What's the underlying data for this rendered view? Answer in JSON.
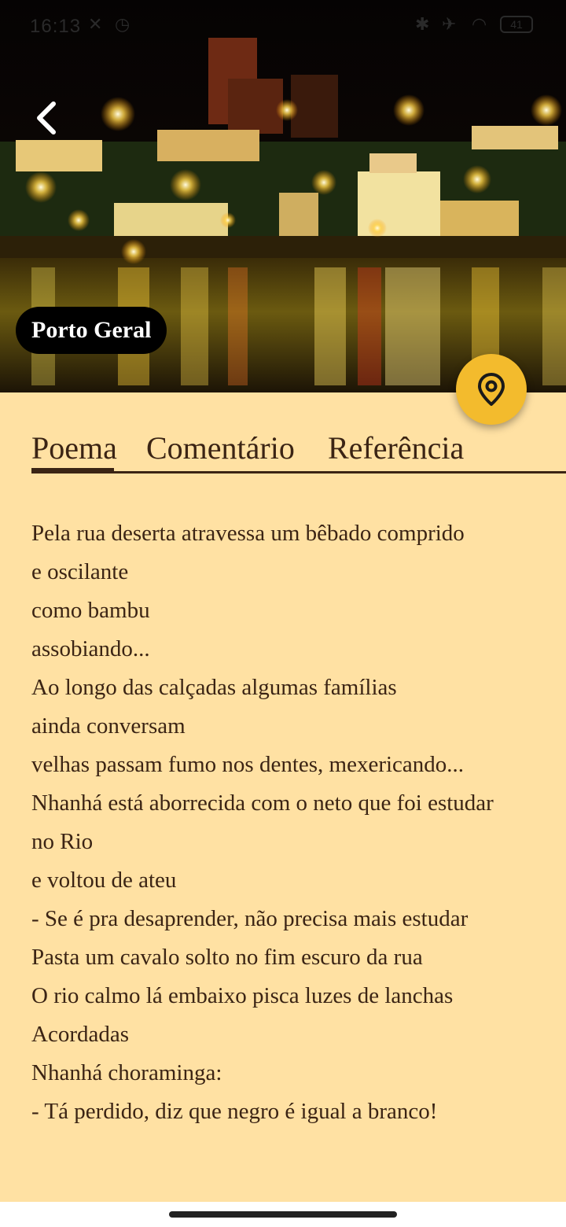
{
  "status_bar": {
    "time": "16:13",
    "icons": [
      "bluetooth-icon",
      "airplane-mode-icon",
      "wifi-icon",
      "battery-icon"
    ],
    "battery_text": "41"
  },
  "header": {
    "place_name": "Porto Geral",
    "back_icon": "chevron-left-icon",
    "map_icon": "location-pin-icon"
  },
  "tabs": [
    {
      "label": "Poema",
      "selected": true
    },
    {
      "label": "Comentário",
      "selected": false
    },
    {
      "label": "Referência",
      "selected": false
    }
  ],
  "poem": {
    "lines": [
      "Pela rua deserta atravessa um bêbado comprido",
      "e oscilante",
      "como bambu",
      "assobiando...",
      "Ao longo das calçadas algumas famílias",
      "ainda conversam",
      "velhas passam fumo nos dentes, mexericando...",
      "Nhanhá está aborrecida com o neto que foi estudar",
      "no Rio",
      "e voltou de ateu",
      "- Se é pra desaprender, não precisa mais estudar",
      "Pasta um cavalo solto no fim escuro da rua",
      "O rio calmo lá embaixo pisca luzes de lanchas",
      "Acordadas",
      "Nhanhá choraminga:",
      "- Tá perdido, diz que negro é igual a branco!"
    ]
  },
  "colors": {
    "background": "#ffe1a3",
    "text": "#3b2414",
    "fab": "#f3bb2d",
    "chip": "#000000"
  }
}
